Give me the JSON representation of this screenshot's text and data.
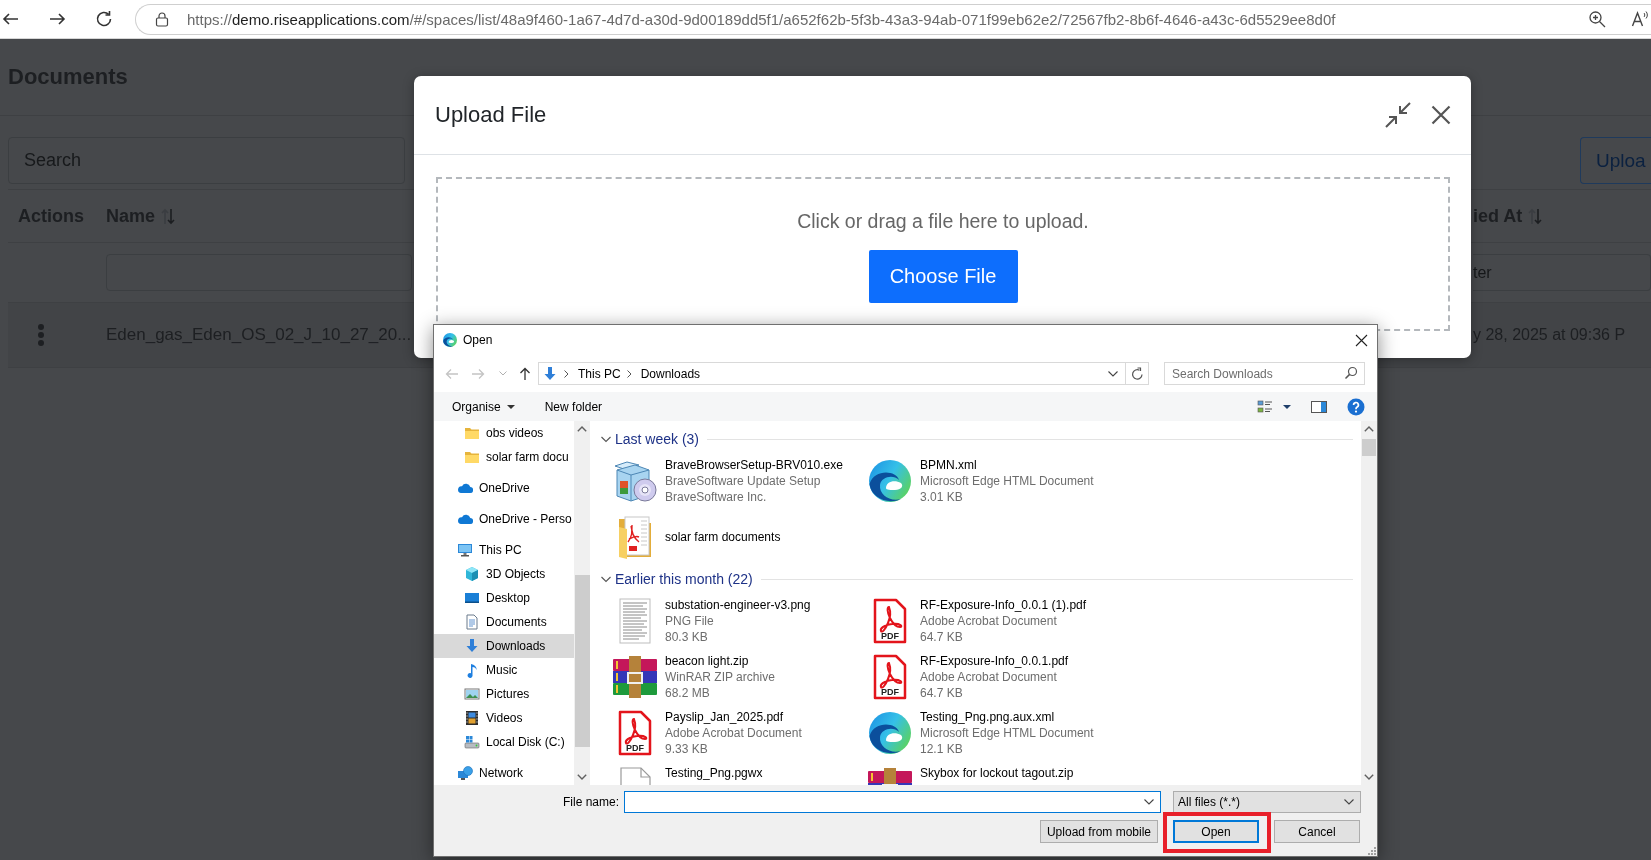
{
  "browser": {
    "url": {
      "scheme": "https://",
      "host": "demo.riseapplications.com",
      "path": "/#/spaces/list/48a9f460-1a67-4d7d-a30d-9d00189dd5f1/a652f62b-5f3b-43a3-94ab-071f99eb62e2/72567fb2-8b6f-4646-a43c-6d5529ee8d0f"
    }
  },
  "page": {
    "title": "Documents",
    "search": {
      "placeholder": "Search"
    },
    "upload_button": "Uploa",
    "table": {
      "columns": [
        {
          "label": "Actions",
          "sortable": false,
          "filterable": false
        },
        {
          "label": "Name",
          "sortable": true,
          "filterable": true
        },
        {
          "label": "ied At",
          "sortable": true,
          "filterable": true,
          "filter_placeholder": "ter"
        }
      ],
      "rows": [
        {
          "name": "Eden_gas_Eden_OS_02_J_10_27_20...",
          "modified_at": "y 28, 2025 at 09:36 P"
        }
      ]
    }
  },
  "upload_modal": {
    "title": "Upload File",
    "dropzone_text": "Click or drag a file here to upload.",
    "choose_button": "Choose File"
  },
  "open_dialog": {
    "title": "Open",
    "back": {
      "disabled": true
    },
    "forward": {
      "disabled": true
    },
    "up": {
      "disabled": false
    },
    "breadcrumb": [
      "This PC",
      "Downloads"
    ],
    "search_placeholder": "Search Downloads",
    "toolbar": {
      "organise": "Organise",
      "new_folder": "New folder"
    },
    "navigation": {
      "quick_access_children": [
        {
          "label": "obs videos",
          "kind": "folder",
          "selected": false
        },
        {
          "label": "solar farm docu",
          "kind": "folder",
          "selected": false
        }
      ],
      "items": [
        {
          "label": "OneDrive",
          "kind": "cloud",
          "selected": false
        },
        {
          "label": "OneDrive - Perso",
          "kind": "cloud",
          "selected": false
        },
        {
          "label": "This PC",
          "kind": "computer",
          "selected": false,
          "children": [
            {
              "label": "3D Objects",
              "kind": "cube",
              "selected": false
            },
            {
              "label": "Desktop",
              "kind": "desktop",
              "selected": false
            },
            {
              "label": "Documents",
              "kind": "documents",
              "selected": false
            },
            {
              "label": "Downloads",
              "kind": "downloads",
              "selected": true
            },
            {
              "label": "Music",
              "kind": "music",
              "selected": false
            },
            {
              "label": "Pictures",
              "kind": "pictures",
              "selected": false
            },
            {
              "label": "Videos",
              "kind": "videos",
              "selected": false
            },
            {
              "label": "Local Disk (C:)",
              "kind": "drive",
              "selected": false
            }
          ]
        },
        {
          "label": "Network",
          "kind": "network",
          "selected": false
        }
      ]
    },
    "groups": [
      {
        "title": "Last week (3)",
        "expanded": true,
        "files": [
          {
            "name": "BraveBrowserSetup-BRV010.exe",
            "type": "BraveSoftware Update Setup",
            "detail": "BraveSoftware Inc.",
            "kind": "installer",
            "cut_off": false
          },
          {
            "name": "BPMN.xml",
            "type": "Microsoft Edge HTML Document",
            "detail": "3.01 KB",
            "kind": "web",
            "cut_off": false
          },
          {
            "name": "solar farm documents",
            "kind": "folder",
            "cut_off": false
          }
        ]
      },
      {
        "title": "Earlier this month (22)",
        "expanded": true,
        "files": [
          {
            "name": "substation-engineer-v3.png",
            "type": "PNG File",
            "detail": "80.3 KB",
            "kind": "image",
            "cut_off": false
          },
          {
            "name": "RF-Exposure-Info_0.0.1 (1).pdf",
            "type": "Adobe Acrobat Document",
            "detail": "64.7 KB",
            "kind": "pdf",
            "icon_label": "PDF",
            "cut_off": false
          },
          {
            "name": "beacon light.zip",
            "type": "WinRAR ZIP archive",
            "detail": "68.2 MB",
            "kind": "archive",
            "cut_off": false
          },
          {
            "name": "RF-Exposure-Info_0.0.1.pdf",
            "type": "Adobe Acrobat Document",
            "detail": "64.7 KB",
            "kind": "pdf",
            "icon_label": "PDF",
            "cut_off": false
          },
          {
            "name": "Payslip_Jan_2025.pdf",
            "type": "Adobe Acrobat Document",
            "detail": "9.33 KB",
            "kind": "pdf",
            "icon_label": "PDF",
            "cut_off": false
          },
          {
            "name": "Testing_Png.png.aux.xml",
            "type": "Microsoft Edge HTML Document",
            "detail": "12.1 KB",
            "kind": "web",
            "cut_off": false
          },
          {
            "name": "Testing_Png.pgwx",
            "kind": "blank",
            "cut_off": true
          },
          {
            "name": "Skybox for lockout tagout.zip",
            "kind": "archive",
            "cut_off": true
          }
        ]
      }
    ],
    "file_name": {
      "label": "File name:"
    },
    "file_type": "All files (*.*)",
    "buttons": [
      {
        "label": "Upload from mobile",
        "kind": "normal",
        "highlighted": false
      },
      {
        "label": "Open",
        "kind": "default",
        "highlighted": true
      },
      {
        "label": "Cancel",
        "kind": "normal",
        "highlighted": false
      }
    ]
  }
}
